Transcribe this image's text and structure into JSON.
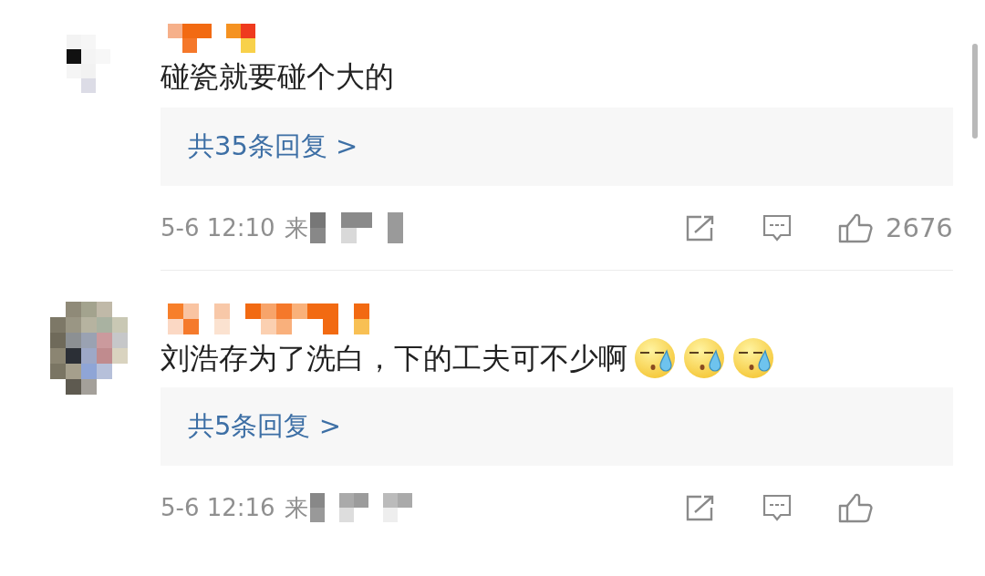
{
  "comments": [
    {
      "text": "碰瓷就要碰个大的",
      "replies": "共35条回复 >",
      "time": "5-6 12:10",
      "source": "来",
      "likes": "2676"
    },
    {
      "text": "刘浩存为了洗白，下的工夫可不少啊",
      "emojis": [
        {
          "kind": "sweat"
        },
        {
          "kind": "sweat"
        },
        {
          "kind": "sweat"
        }
      ],
      "replies": "共5条回复 >",
      "time": "5-6 12:16",
      "source": "来"
    }
  ]
}
